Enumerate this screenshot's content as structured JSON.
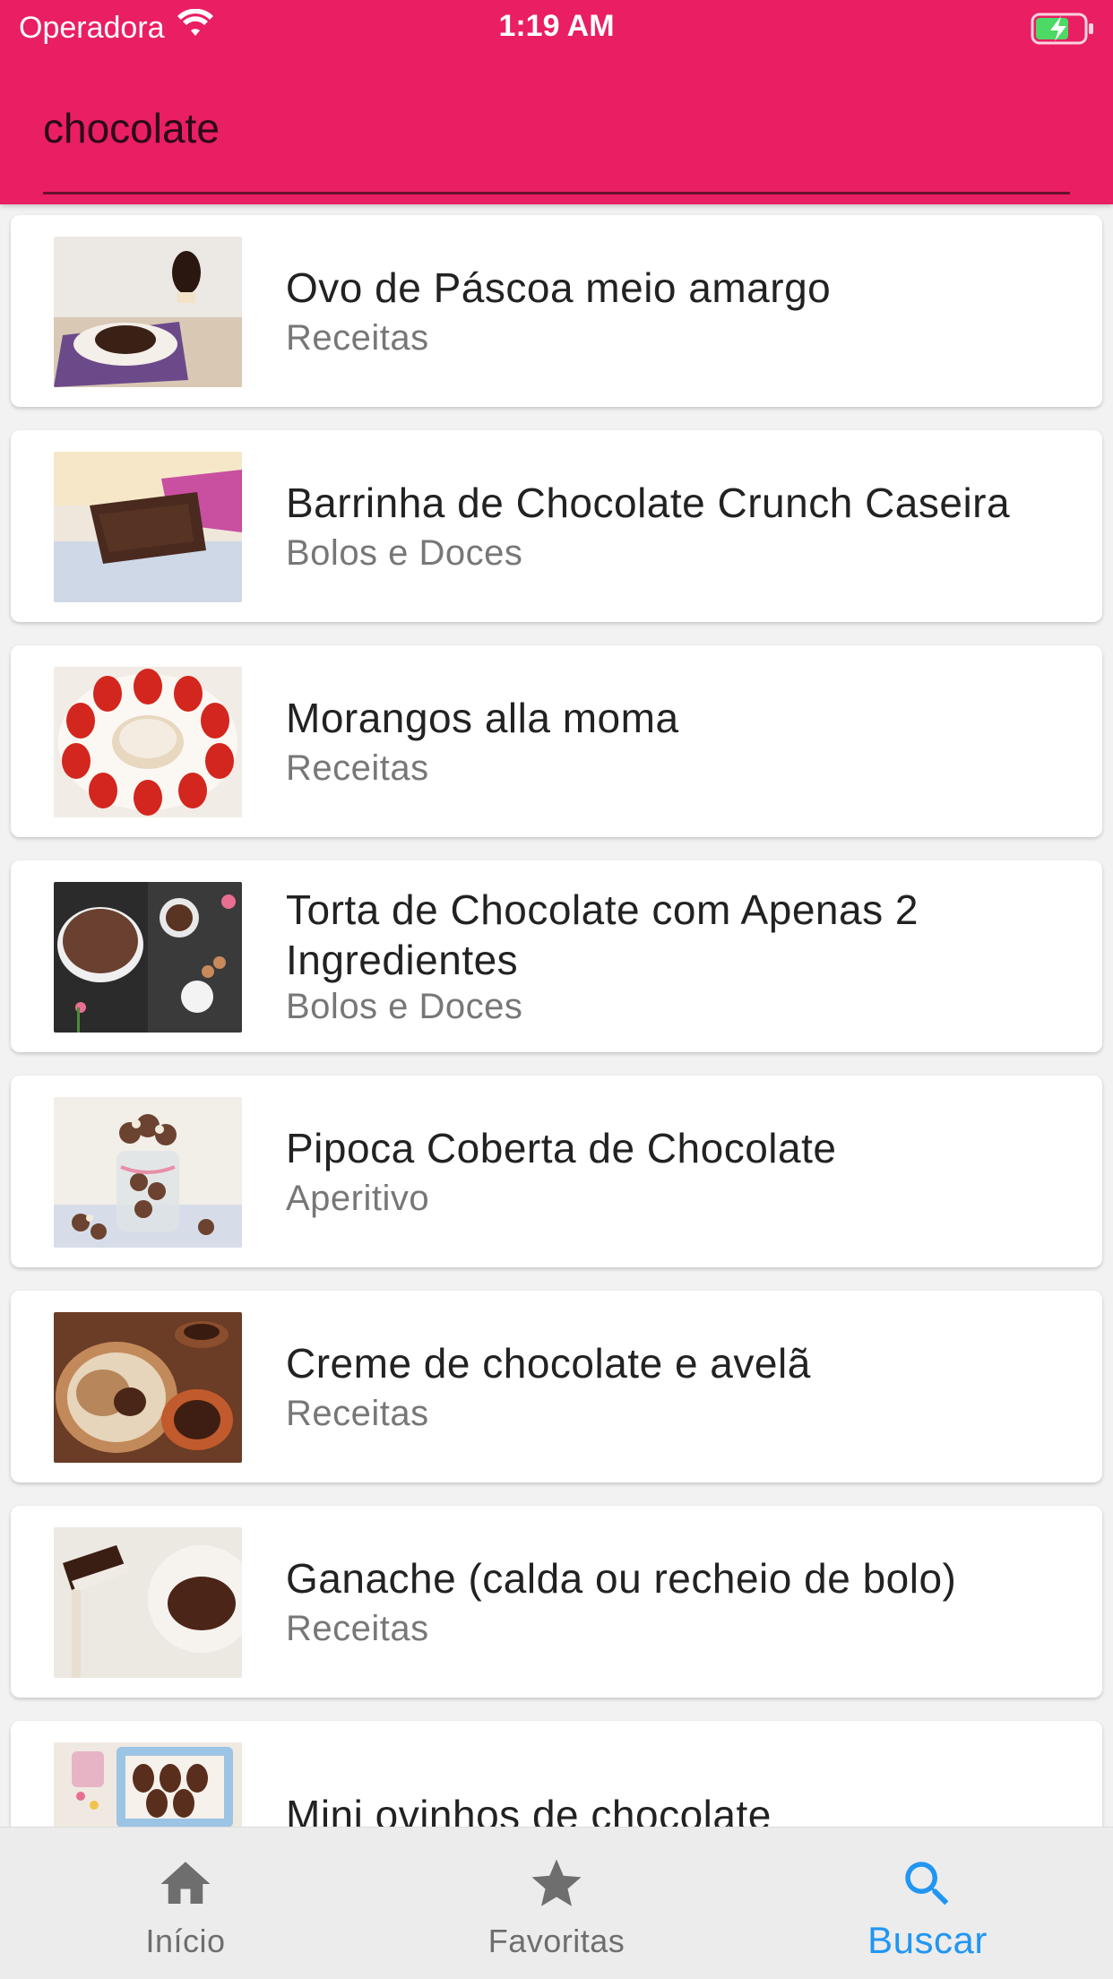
{
  "status_bar": {
    "carrier": "Operadora",
    "time": "1:19 AM"
  },
  "search": {
    "value": "chocolate",
    "placeholder": ""
  },
  "results": [
    {
      "title": "Ovo de Páscoa meio amargo",
      "category": "Receitas"
    },
    {
      "title": "Barrinha de Chocolate Crunch Caseira",
      "category": "Bolos e Doces"
    },
    {
      "title": "Morangos alla moma",
      "category": "Receitas"
    },
    {
      "title": "Torta de Chocolate com Apenas 2 Ingredientes",
      "category": "Bolos e Doces"
    },
    {
      "title": "Pipoca Coberta de Chocolate",
      "category": "Aperitivo"
    },
    {
      "title": "Creme de chocolate e avelã",
      "category": "Receitas"
    },
    {
      "title": "Ganache (calda ou recheio de bolo)",
      "category": "Receitas"
    },
    {
      "title": "Mini ovinhos de chocolate",
      "category": ""
    }
  ],
  "bottom_nav": {
    "items": [
      {
        "label": "Início",
        "icon": "home-icon"
      },
      {
        "label": "Favoritas",
        "icon": "star-icon"
      },
      {
        "label": "Buscar",
        "icon": "search-icon"
      }
    ],
    "active": "Buscar"
  },
  "colors": {
    "header": "#e91e63",
    "active_tab": "#2196f3",
    "inactive_tab": "#6e6e6e"
  }
}
